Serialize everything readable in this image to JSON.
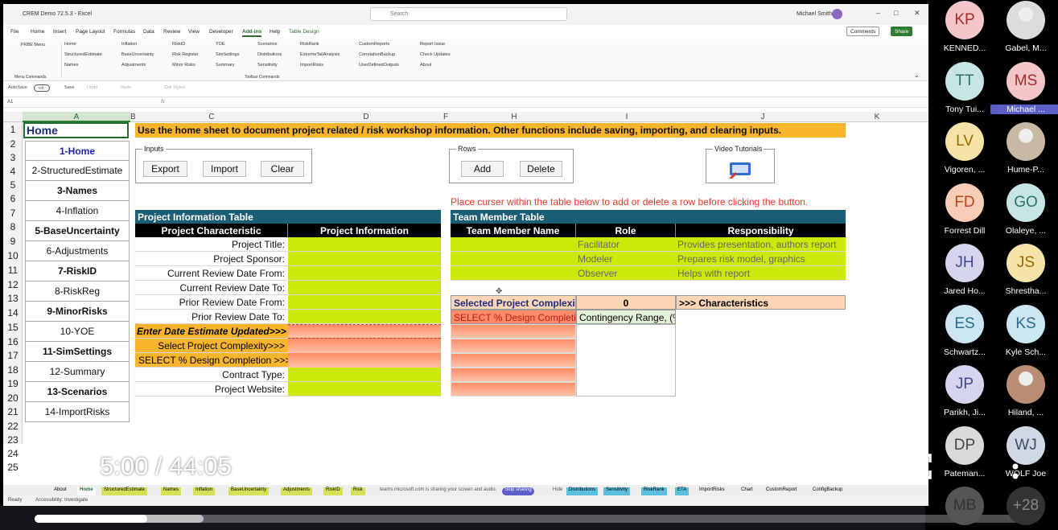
{
  "excel": {
    "window_title": "CREM Demo 72.5.3  -  Excel",
    "search_placeholder": "Search",
    "user_name": "Michael Smith",
    "menu": [
      "File",
      "Home",
      "Insert",
      "Page Layout",
      "Formulas",
      "Data",
      "Review",
      "View",
      "Developer",
      "Add-ins",
      "Help",
      "Table Design"
    ],
    "comments_label": "Comments",
    "share_label": "Share",
    "ribbon": {
      "prbe_menu": "PRBE Menu",
      "menu_commands": "Menu Commands",
      "toolbar_commands": "Toolbar Commands",
      "cols": [
        [
          "Home",
          "StructuredEstimate",
          "Names"
        ],
        [
          "Inflation",
          "BaseUncertainty",
          "Adjustments"
        ],
        [
          "RiskID",
          "Risk Register",
          "Minor Risks"
        ],
        [
          "YOE",
          "SimSettings",
          "Summary"
        ],
        [
          "Scenarios",
          "Distributions",
          "Sensitivity"
        ],
        [
          "RiskRank",
          "ExtremeTailAnalysis",
          "ImportRisks"
        ],
        [
          "CustomReports",
          "CorrelationBackup",
          "UserDefinedOutputs"
        ],
        [
          "Report Issue",
          "Check Updates",
          "About"
        ]
      ]
    },
    "qat": {
      "autosave": "AutoSave",
      "off": "Off",
      "save": "Save",
      "undo": "Undo",
      "redo": "Redo",
      "cell_styles": "Cell Styles"
    },
    "name_box": "A1",
    "columns": [
      "A",
      "B",
      "C",
      "D",
      "F",
      "H",
      "I",
      "J",
      "K"
    ],
    "rows": [
      "1",
      "2",
      "3",
      "4",
      "5",
      "6",
      "7",
      "8",
      "9",
      "10",
      "11",
      "12",
      "13",
      "14",
      "15",
      "16",
      "17",
      "18",
      "19",
      "20",
      "21",
      "22",
      "23",
      "24",
      "25"
    ],
    "a1": "Home",
    "nav": [
      "1-Home",
      "2-StructuredEstimate",
      "3-Names",
      "4-Inflation",
      "5-BaseUncertainty",
      "6-Adjustments",
      "7-RiskID",
      "8-RiskReg",
      "9-MinorRisks",
      "10-YOE",
      "11-SimSettings",
      "12-Summary",
      "13-Scenarios",
      "14-ImportRisks"
    ],
    "banner": "Use the home sheet to document project related / risk workshop information.  Other functions include saving, importing, and clearing inputs.",
    "inputs_group": {
      "label": "Inputs",
      "export": "Export",
      "import": "Import",
      "clear": "Clear"
    },
    "rows_group": {
      "label": "Rows",
      "add": "Add",
      "delete": "Delete"
    },
    "video_label": "Video Tutorials",
    "red_note": "Place curser within the table below to add or delete a row before clicking the button.",
    "project_table": {
      "title": "Project Information Table",
      "col1": "Project  Characteristic",
      "col2": "Project Information",
      "labels": [
        "Project Title:",
        "Project Sponsor:",
        "Current Review Date From:",
        "Current Review Date To:",
        "Prior Review Date From:",
        "Prior Review Date To:",
        "Enter Date Estimate Updated>>>",
        "Select Project Complexity>>>",
        "SELECT % Design Completion >>>",
        "Contract Type:",
        "Project Website:"
      ]
    },
    "team_table": {
      "title": "Team Member Table",
      "cols": [
        "Team Member Name",
        "Role",
        "Responsibility"
      ],
      "rows": [
        {
          "name": "",
          "role": "Facilitator",
          "resp": "Provides presentation, authors report"
        },
        {
          "name": "",
          "role": "Modeler",
          "resp": "Prepares risk model, graphics"
        },
        {
          "name": "",
          "role": "Observer",
          "resp": "Helps with report"
        }
      ]
    },
    "complexity": {
      "label": "Selected Project Complexity:",
      "value": "0",
      "characteristics": ">>> Characteristics"
    },
    "design": {
      "label": "SELECT % Design Completion",
      "range": "Contingency Range, (%)"
    },
    "tabs": [
      "About",
      "Home",
      "StructuredEstimate",
      "Names",
      "Inflation",
      "BaseUncertainty",
      "Adjustments",
      "RiskID",
      "Risk",
      "Distributions",
      "Sensitivity",
      "RiskRank",
      "ETA",
      "ImportRisks",
      "Chart",
      "CustomReport",
      "ConfigBackup"
    ],
    "share_banner": "teams.microsoft.com is sharing your screen and audio.",
    "stop_sharing": "Stop sharing",
    "hide": "Hide",
    "status_ready": "Ready",
    "accessibility": "Accessibility: Investigate"
  },
  "video": {
    "time": "5:00 / 44:05",
    "progress_fraction": 0.113
  },
  "participants": [
    {
      "initials": "KP",
      "name": "KENNED...",
      "bg": "#f3c7c7",
      "fg": "#a52a2a",
      "photo": false
    },
    {
      "initials": "",
      "name": "Gabel, M...",
      "bg": "#dcdcdc",
      "fg": "#fff",
      "photo": true
    },
    {
      "initials": "TT",
      "name": "Tony Tui...",
      "bg": "#c7e6e3",
      "fg": "#2f6f68",
      "photo": false
    },
    {
      "initials": "MS",
      "name": "Michael ...",
      "bg": "#f3c7c7",
      "fg": "#a52a2a",
      "photo": false,
      "highlight": true
    },
    {
      "initials": "LV",
      "name": "Vigoren, ...",
      "bg": "#f6e3a8",
      "fg": "#9a6a00",
      "photo": false
    },
    {
      "initials": "",
      "name": "Hume-P...",
      "bg": "#c9b9a4",
      "fg": "#fff",
      "photo": true
    },
    {
      "initials": "FD",
      "name": "Forrest Dill",
      "bg": "#f7cdb8",
      "fg": "#b4461a",
      "photo": false
    },
    {
      "initials": "GO",
      "name": "Olaleye, ...",
      "bg": "#c7e6e3",
      "fg": "#2f6f68",
      "photo": false
    },
    {
      "initials": "JH",
      "name": "Jared Ho...",
      "bg": "#d4d6ee",
      "fg": "#44478a",
      "photo": false
    },
    {
      "initials": "JS",
      "name": "Shrestha...",
      "bg": "#f6e3a8",
      "fg": "#9a6a00",
      "photo": false
    },
    {
      "initials": "ES",
      "name": "Schwartz...",
      "bg": "#cde6f3",
      "fg": "#2a6a8a",
      "photo": false
    },
    {
      "initials": "KS",
      "name": "Kyle Sch...",
      "bg": "#cde6f3",
      "fg": "#2a6a8a",
      "photo": false
    },
    {
      "initials": "JP",
      "name": "Parikh, Ji...",
      "bg": "#d4d6ee",
      "fg": "#44478a",
      "photo": false
    },
    {
      "initials": "",
      "name": "Hiland, ...",
      "bg": "#b98e74",
      "fg": "#fff",
      "photo": true
    },
    {
      "initials": "DP",
      "name": "Pateman...",
      "bg": "#d9d9d9",
      "fg": "#444",
      "photo": false
    },
    {
      "initials": "WJ",
      "name": "WOLF Joe",
      "bg": "#d0d8e6",
      "fg": "#3b4a66",
      "photo": false
    },
    {
      "initials": "MB",
      "name": "",
      "bg": "#555",
      "fg": "#333",
      "photo": false
    },
    {
      "initials": "+28",
      "name": "",
      "bg": "#333",
      "fg": "#888",
      "photo": false
    }
  ]
}
